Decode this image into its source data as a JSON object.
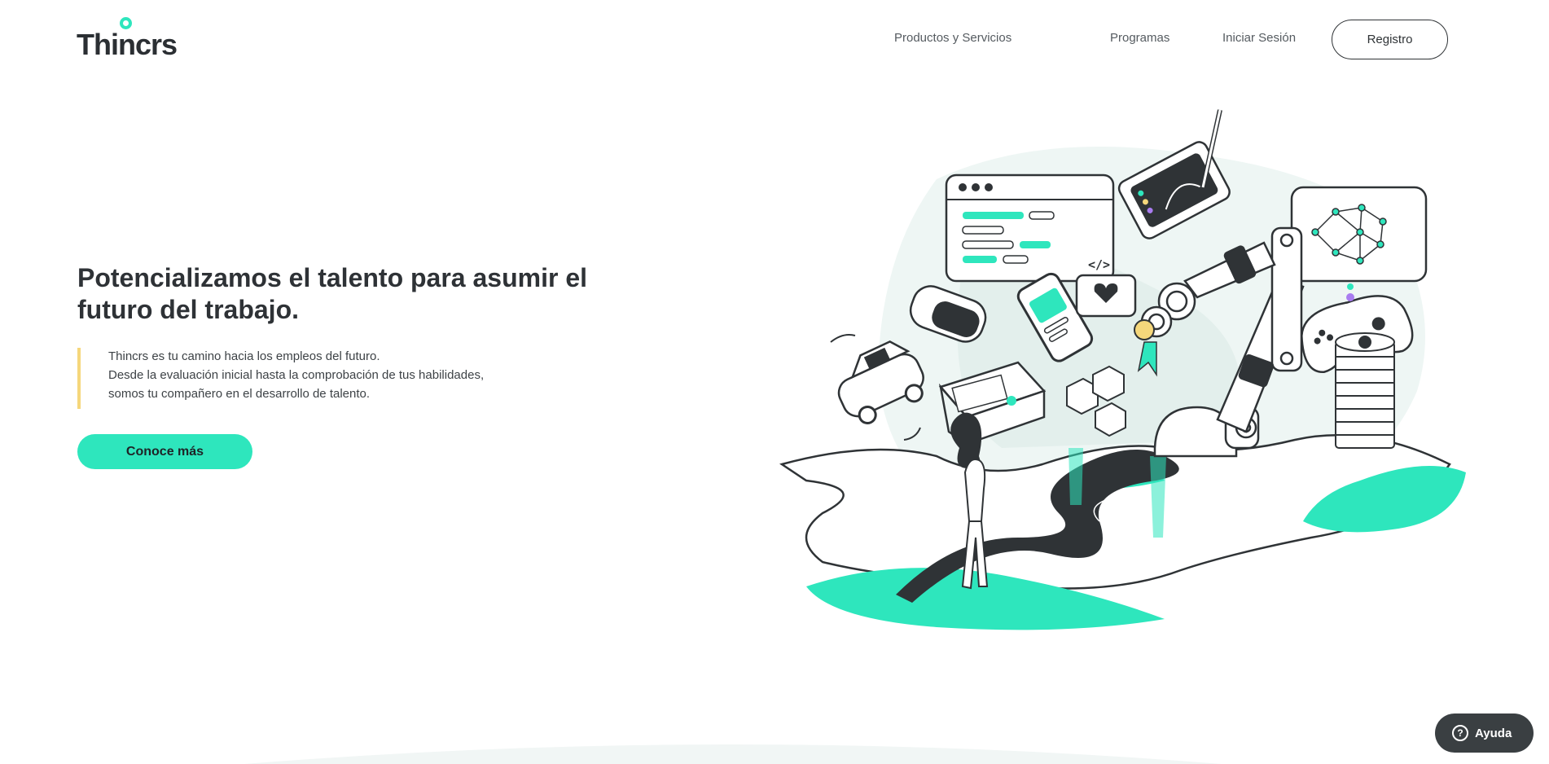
{
  "header": {
    "logo_text": "Thincrs",
    "nav": {
      "products": "Productos y Servicios",
      "programs": "Programas",
      "login": "Iniciar Sesión",
      "register": "Registro"
    }
  },
  "hero": {
    "title": "Potencializamos el talento para asumir el futuro del trabajo.",
    "description": [
      "Thincrs es tu camino hacia los empleos del futuro.",
      "Desde la evaluación inicial hasta la comprobación de tus habilidades,",
      "somos tu compañero en el desarrollo de talento."
    ],
    "cta": "Conoce más"
  },
  "help": {
    "icon": "question-circle-icon",
    "label": "Ayuda"
  },
  "colors": {
    "accent": "#2ee6bd",
    "quote_bar": "#f5d77b",
    "dark": "#2f3336"
  }
}
